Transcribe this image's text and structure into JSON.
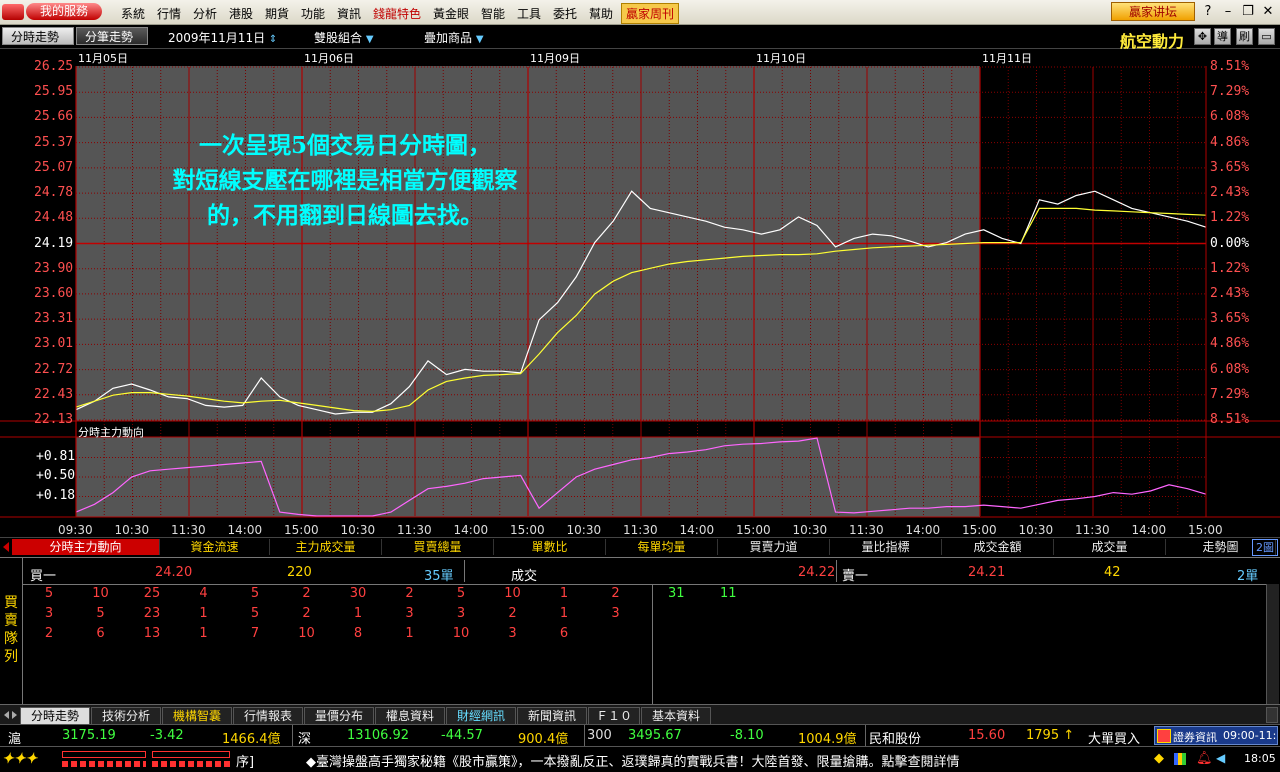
{
  "menubar": {
    "my_service": "我的服務",
    "items": [
      "系統",
      "行情",
      "分析",
      "港股",
      "期貨",
      "功能",
      "資訊",
      "錢龍特色",
      "黃金眼",
      "智能",
      "工具",
      "委托",
      "幫助",
      "贏家周刊"
    ],
    "forum": "贏家讲坛"
  },
  "toolbar": {
    "tab_timeshare": "分時走勢",
    "tab_trades": "分筆走勢",
    "date": "2009年11月11日",
    "combo": "雙股組合",
    "overlay": "疊加商品",
    "stock_name": "航空動力",
    "btn_nav": "導",
    "btn_refresh": "刷"
  },
  "chart_data": {
    "type": "line",
    "dates": [
      "11月05日",
      "11月06日",
      "11月09日",
      "11月10日",
      "11月11日"
    ],
    "price_ticks": [
      "26.25",
      "25.95",
      "25.66",
      "25.37",
      "25.07",
      "24.78",
      "24.48",
      "24.19",
      "23.90",
      "23.60",
      "23.31",
      "23.01",
      "22.72",
      "22.43",
      "22.13"
    ],
    "pct_ticks": [
      "8.51%",
      "7.29%",
      "6.08%",
      "4.86%",
      "3.65%",
      "2.43%",
      "1.22%",
      "0.00%",
      "1.22%",
      "2.43%",
      "3.65%",
      "4.86%",
      "6.08%",
      "7.29%",
      "8.51%"
    ],
    "ylim": [
      22.13,
      26.25
    ],
    "reference_price": 24.19,
    "time_ticks": [
      "09:30",
      "10:30",
      "11:30",
      "14:00",
      "15:00",
      "10:30",
      "11:30",
      "14:00",
      "15:00",
      "10:30",
      "11:30",
      "14:00",
      "15:00",
      "10:30",
      "11:30",
      "14:00",
      "15:00",
      "10:30",
      "11:30",
      "14:00",
      "15:00"
    ],
    "series": [
      {
        "name": "price",
        "color": "#ffffff",
        "values": [
          22.25,
          22.35,
          22.5,
          22.55,
          22.48,
          22.4,
          22.38,
          22.3,
          22.28,
          22.3,
          22.62,
          22.4,
          22.3,
          22.25,
          22.2,
          22.22,
          22.22,
          22.32,
          22.52,
          22.82,
          22.66,
          22.72,
          22.7,
          22.7,
          22.68,
          23.3,
          23.5,
          23.8,
          24.2,
          24.45,
          24.8,
          24.6,
          24.55,
          24.5,
          24.45,
          24.38,
          24.35,
          24.3,
          24.35,
          24.5,
          24.4,
          24.15,
          24.25,
          24.3,
          24.28,
          24.22,
          24.15,
          24.2,
          24.3,
          24.35,
          24.25,
          24.19,
          24.7,
          24.65,
          24.75,
          24.8,
          24.7,
          24.6,
          24.55,
          24.5,
          24.45,
          24.38
        ]
      },
      {
        "name": "avg",
        "color": "#ffff33",
        "values": [
          22.28,
          22.35,
          22.42,
          22.45,
          22.45,
          22.43,
          22.41,
          22.38,
          22.35,
          22.33,
          22.35,
          22.36,
          22.33,
          22.3,
          22.27,
          22.24,
          22.23,
          22.25,
          22.3,
          22.48,
          22.58,
          22.62,
          22.65,
          22.66,
          22.67,
          22.9,
          23.15,
          23.35,
          23.6,
          23.75,
          23.85,
          23.9,
          23.95,
          23.98,
          24.0,
          24.02,
          24.04,
          24.05,
          24.06,
          24.06,
          24.07,
          24.1,
          24.12,
          24.14,
          24.15,
          24.16,
          24.17,
          24.18,
          24.19,
          24.2,
          24.2,
          24.2,
          24.6,
          24.6,
          24.6,
          24.58,
          24.57,
          24.56,
          24.55,
          24.54,
          24.53,
          24.52
        ]
      }
    ],
    "indicator": {
      "title": "分時主力動向",
      "ticks": [
        "+0.81",
        "+0.50",
        "+0.18"
      ],
      "ylim": [
        0,
        1.0
      ],
      "values": [
        0.05,
        0.15,
        0.3,
        0.5,
        0.58,
        0.6,
        0.62,
        0.64,
        0.66,
        0.68,
        0.7,
        0.05,
        0.02,
        0.0,
        0.0,
        0.0,
        0.0,
        0.05,
        0.2,
        0.35,
        0.38,
        0.42,
        0.48,
        0.5,
        0.52,
        0.1,
        0.3,
        0.5,
        0.6,
        0.66,
        0.72,
        0.75,
        0.8,
        0.82,
        0.85,
        0.9,
        0.92,
        0.93,
        0.95,
        0.96,
        1.0,
        0.05,
        0.04,
        0.06,
        0.08,
        0.1,
        0.1,
        0.12,
        0.12,
        0.14,
        0.12,
        0.1,
        0.15,
        0.2,
        0.22,
        0.25,
        0.3,
        0.28,
        0.32,
        0.4,
        0.35,
        0.28
      ]
    }
  },
  "annotation": [
    "一次呈現5個交易日分時圖，",
    "對短線支壓在哪裡是相當方便觀察",
    "的，不用翻到日線圖去找。"
  ],
  "indicator_tabs": [
    "分時主力動向",
    "資金流速",
    "主力成交量",
    "買賣總量",
    "單數比",
    "每單均量",
    "買賣力道",
    "量比指標",
    "成交金額",
    "成交量",
    "走勢圖"
  ],
  "page_badge": "2圖",
  "book": {
    "side_label": "買賣隊列",
    "bid_label": "買一",
    "bid_price": "24.20",
    "bid_vol": "220",
    "bid_count": "35單",
    "trade_label": "成交",
    "trade_price": "24.22",
    "ask_label": "賣一",
    "ask_price": "24.21",
    "ask_vol": "42",
    "ask_count": "2單",
    "bid_rows": [
      [
        "5",
        "10",
        "25",
        "4",
        "5",
        "2",
        "30",
        "2",
        "5",
        "10",
        "1",
        "2"
      ],
      [
        "3",
        "5",
        "23",
        "1",
        "5",
        "2",
        "1",
        "3",
        "3",
        "2",
        "1",
        "3"
      ],
      [
        "2",
        "6",
        "13",
        "1",
        "7",
        "10",
        "8",
        "1",
        "10",
        "3",
        "6"
      ]
    ],
    "ask_row": [
      "31",
      "11"
    ]
  },
  "bottom_tabs": [
    "分時走勢",
    "技術分析",
    "機構智囊",
    "行情報表",
    "量價分布",
    "權息資料",
    "財經網訊",
    "新聞資訊",
    "Ｆ１０",
    "基本資料"
  ],
  "quotes": {
    "sh_label": "滬",
    "sh_index": "3175.19",
    "sh_change": "-3.42",
    "sh_amount": "1466.4億",
    "sz_label": "深",
    "sz_index": "13106.92",
    "sz_change": "-44.57",
    "sz_amount": "900.4億",
    "idx300_label": "300",
    "idx300_value": "3495.67",
    "idx300_change": "-8.10",
    "idx300_amount": "1004.9億",
    "stock": "民和股份",
    "stock_price": "15.60",
    "stock_vol": "1795 ↑",
    "stock_note": "大單買入",
    "securities": "證券資訊",
    "sessions": "09:00-11:"
  },
  "ticker": {
    "prefix": "序]",
    "text": "◆臺灣操盤高手獨家秘籍《股市贏策》，一本撥亂反正、返璞歸真的實戰兵書！大陸首發、限量搶購。點擊查閱詳情",
    "time": "18:05"
  },
  "colors": {
    "grid": "#8b0000",
    "chart_bg": "#555555",
    "up": "#ff4040",
    "down": "#40ff40",
    "annotation": "#00ffff"
  }
}
